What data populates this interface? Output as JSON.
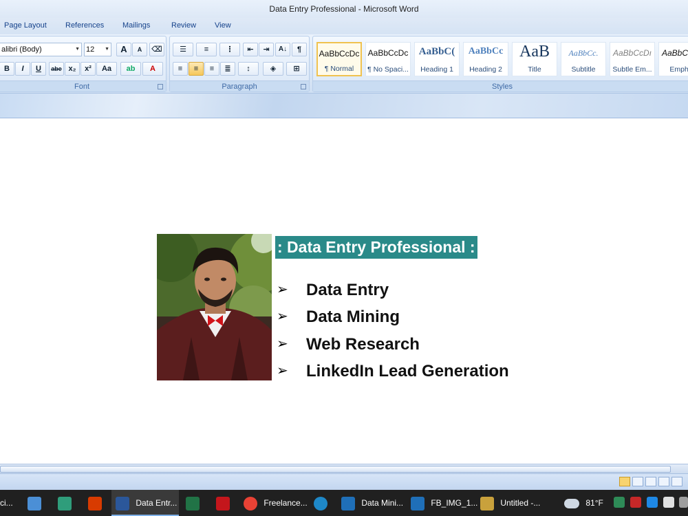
{
  "window": {
    "title": "Data Entry Professional - Microsoft Word"
  },
  "tabs": [
    "Page Layout",
    "References",
    "Mailings",
    "Review",
    "View"
  ],
  "ribbon": {
    "font_group": {
      "label": "Font",
      "font_name": "alibri (Body)",
      "font_size": "12",
      "grow_label": "A",
      "shrink_label": "A",
      "bold": "B",
      "italic": "I",
      "underline": "U",
      "strike": "abe",
      "subscript": "x₂",
      "superscript": "x²",
      "change_case": "Aa",
      "highlight": "ab",
      "font_color": "A"
    },
    "paragraph_group": {
      "label": "Paragraph",
      "sort": "A↓",
      "pilcrow": "¶"
    },
    "styles_group": {
      "label": "Styles",
      "styles": [
        {
          "preview": "AaBbCcDc",
          "name": "¶ Normal",
          "selected": true
        },
        {
          "preview": "AaBbCcDc",
          "name": "¶ No Spaci...",
          "selected": false
        },
        {
          "preview": "AaBbC(",
          "name": "Heading 1",
          "selected": false
        },
        {
          "preview": "AaBbCc",
          "name": "Heading 2",
          "selected": false
        },
        {
          "preview": "AaB",
          "name": "Title",
          "selected": false
        },
        {
          "preview": "AaBbCc.",
          "name": "Subtitle",
          "selected": false
        },
        {
          "preview": "AaBbCcDı",
          "name": "Subtle Em...",
          "selected": false
        },
        {
          "preview": "AaBbCcDı",
          "name": "Empha",
          "selected": false
        }
      ]
    }
  },
  "document": {
    "heading": ": Data Entry Professional :",
    "bullets": [
      "Data Entry",
      "Data Mining",
      "Web Research",
      "LinkedIn Lead Generation"
    ],
    "bullet_glyph": "➢"
  },
  "taskbar": {
    "items": [
      {
        "label": "ci...",
        "icon": "app-icon",
        "color": "#3b6fb6"
      },
      {
        "label": "",
        "icon": "laptop-icon",
        "color": "#4b8fd6"
      },
      {
        "label": "",
        "icon": "download-icon",
        "color": "#2f9d7b"
      },
      {
        "label": "",
        "icon": "office-icon",
        "color": "#d83b01"
      },
      {
        "label": "Data Entr...",
        "icon": "word-icon",
        "color": "#2b579a"
      },
      {
        "label": "",
        "icon": "excel-icon",
        "color": "#217346"
      },
      {
        "label": "",
        "icon": "pdf-icon",
        "color": "#c4161c"
      },
      {
        "label": "Freelance...",
        "icon": "chrome-icon",
        "color": "#e94235"
      },
      {
        "label": "",
        "icon": "edge-icon",
        "color": "#1e88c8"
      },
      {
        "label": "Data Mini...",
        "icon": "photos-icon",
        "color": "#1f6fb8"
      },
      {
        "label": "FB_IMG_1...",
        "icon": "photos-icon",
        "color": "#1f6fb8"
      },
      {
        "label": "Untitled -...",
        "icon": "paint-icon",
        "color": "#c9a13c"
      }
    ],
    "weather": "81°F"
  }
}
